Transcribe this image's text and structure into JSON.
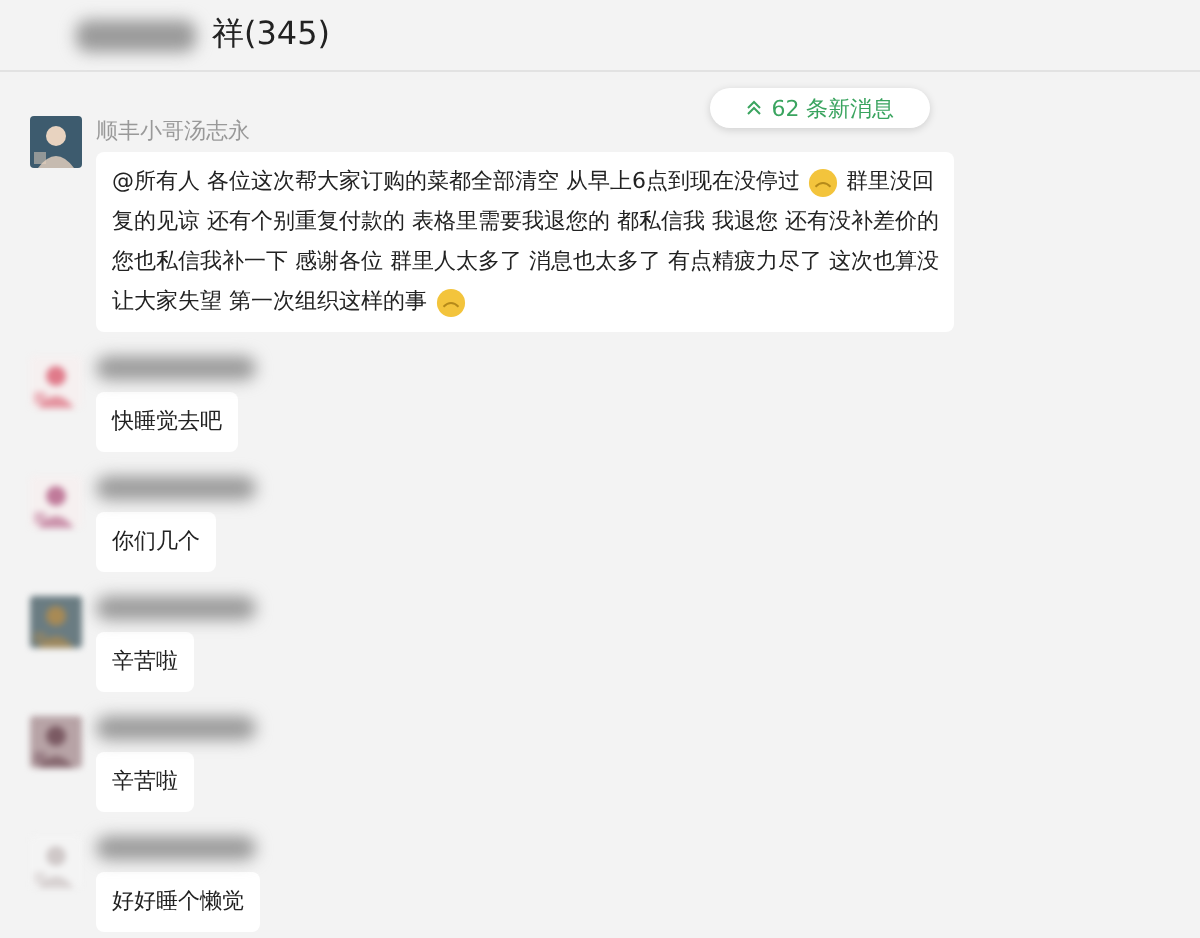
{
  "header": {
    "title": "祥(345)"
  },
  "new_messages": {
    "label": "62 条新消息"
  },
  "messages": [
    {
      "sender": "顺丰小哥汤志永",
      "lines": [
        [
          {
            "kind": "text",
            "text": "@所有人 各位这次帮大家订购的菜都全部清空 从早上6点到现在没停过"
          },
          {
            "kind": "emoji"
          },
          {
            "kind": "text",
            "text": "群里没回"
          }
        ],
        [
          {
            "kind": "text",
            "text": "复的见谅 还有个别重复付款的 表格里需要我退您的 都私信我 我退您 还有没补差价的"
          }
        ],
        [
          {
            "kind": "text",
            "text": "您也私信我补一下 感谢各位 群里人太多了 消息也太多了 有点精疲力尽了 这次也算没"
          }
        ],
        [
          {
            "kind": "text",
            "text": "让大家失望 第一次组织这样的事"
          },
          {
            "kind": "emoji"
          }
        ]
      ]
    },
    {
      "lines": [
        [
          {
            "kind": "text",
            "text": "快睡觉去吧"
          }
        ]
      ]
    },
    {
      "lines": [
        [
          {
            "kind": "text",
            "text": "你们几个"
          }
        ]
      ]
    },
    {
      "lines": [
        [
          {
            "kind": "text",
            "text": "辛苦啦"
          }
        ]
      ]
    },
    {
      "lines": [
        [
          {
            "kind": "text",
            "text": "辛苦啦"
          }
        ]
      ]
    },
    {
      "lines": [
        [
          {
            "kind": "text",
            "text": "好好睡个懒觉"
          }
        ]
      ]
    }
  ]
}
